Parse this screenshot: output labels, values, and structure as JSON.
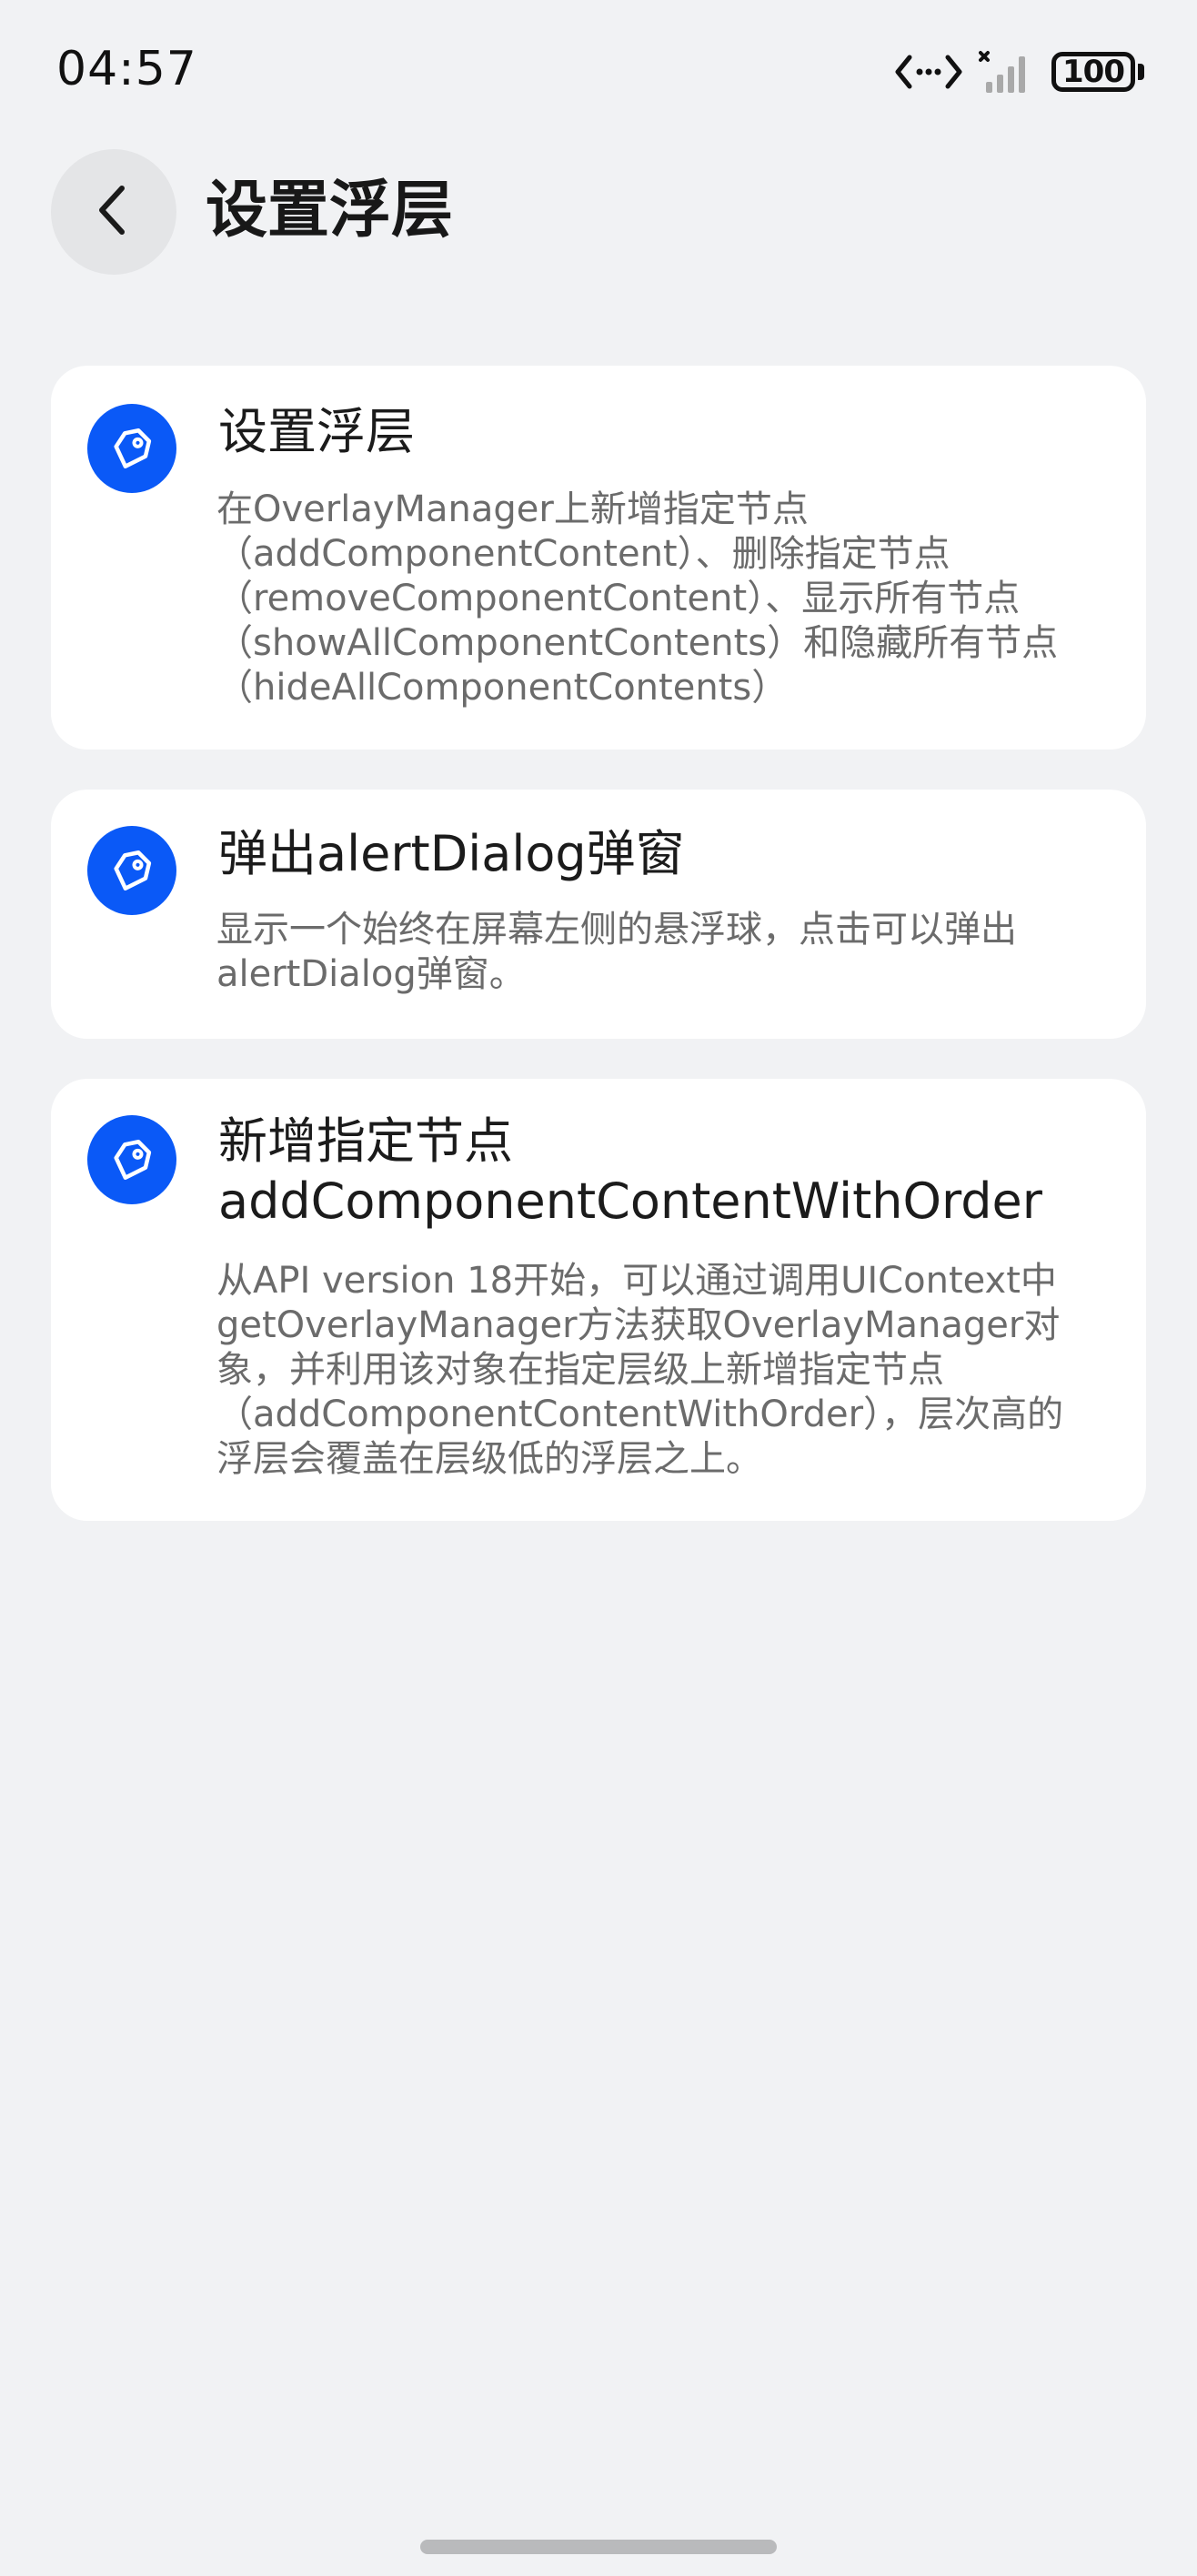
{
  "status_bar": {
    "time": "04:57",
    "battery": "100"
  },
  "header": {
    "title": "设置浮层"
  },
  "cards": [
    {
      "title": "设置浮层",
      "description": "在OverlayManager上新增指定节点\n（addComponentContent）、删除指定节点\n（removeComponentContent）、显示所有节点\n（showAllComponentContents）和隐藏所有节点\n（hideAllComponentContents）"
    },
    {
      "title": "弹出alertDialog弹窗",
      "description": "显示一个始终在屏幕左侧的悬浮球，点击可以弹出\nalertDialog弹窗。"
    },
    {
      "title": "新增指定节点\naddComponentContentWithOrder",
      "description": "从API version 18开始，可以通过调用UIContext中\ngetOverlayManager方法获取OverlayManager对\n象，并利用该对象在指定层级上新增指定节点\n（addComponentContentWithOrder），层次高的\n浮层会覆盖在层级低的浮层之上。"
    }
  ],
  "icons": {
    "back": "chevron-left-icon",
    "card": "tag-icon",
    "network": "code-brackets-icon",
    "signal": "signal-icon"
  },
  "colors": {
    "accent": "#0a59f7",
    "background": "#f1f2f4",
    "card": "#ffffff"
  }
}
